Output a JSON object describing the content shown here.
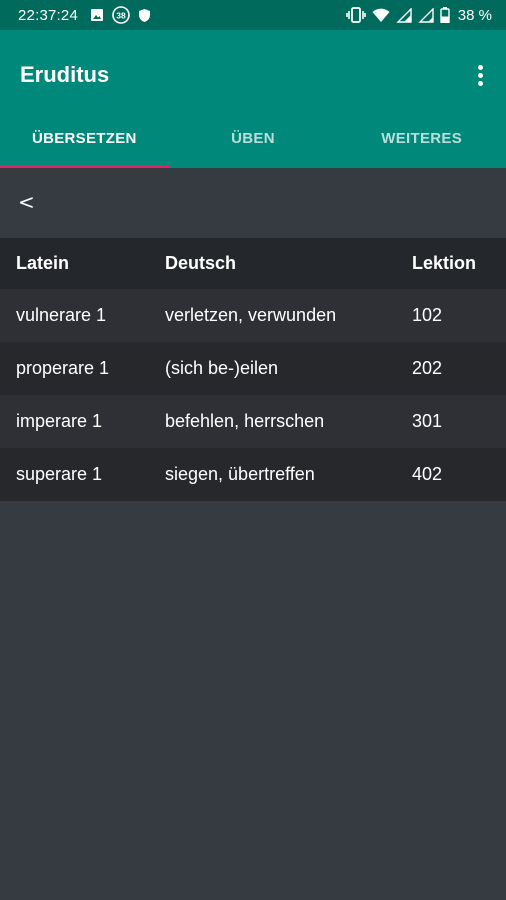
{
  "status_bar": {
    "time": "22:37:24",
    "notification_badge": "38",
    "battery_text": "38 %",
    "icons": [
      "image-icon",
      "badge-38-icon",
      "shield-icon",
      "vibrate-icon",
      "wifi-icon",
      "signal-icon",
      "signal-icon",
      "battery-icon"
    ]
  },
  "app_bar": {
    "title": "Eruditus"
  },
  "tabs": [
    {
      "label": "ÜBERSETZEN",
      "active": true
    },
    {
      "label": "ÜBEN",
      "active": false
    },
    {
      "label": "WEITERES",
      "active": false
    }
  ],
  "back_label": "<",
  "table": {
    "headers": {
      "latin": "Latein",
      "german": "Deutsch",
      "lesson": "Lektion"
    },
    "rows": [
      {
        "latin": "vulnerare 1",
        "german": "verletzen, verwunden",
        "lesson": "102"
      },
      {
        "latin": "properare 1",
        "german": "(sich be-)eilen",
        "lesson": "202"
      },
      {
        "latin": "imperare 1",
        "german": "befehlen, herrschen",
        "lesson": "301"
      },
      {
        "latin": "superare 1",
        "german": "siegen, übertreffen",
        "lesson": "402"
      }
    ]
  },
  "colors": {
    "status_bar": "#006b5c",
    "app_bar": "#00897b",
    "tab_indicator": "#e91e63",
    "background": "#363a41"
  }
}
